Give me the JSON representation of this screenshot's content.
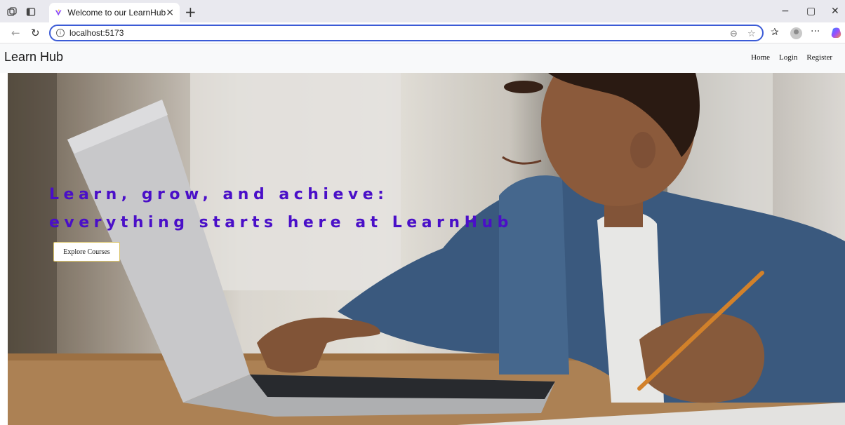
{
  "browser": {
    "tab_title": "Welcome to our LearnHub",
    "url": "localhost:5173",
    "new_tab_symbol": "+",
    "close_tab_symbol": "×",
    "minimize_symbol": "−",
    "restore_symbol": "▢",
    "close_window_symbol": "✕",
    "more_symbol": "···"
  },
  "site": {
    "brand": "Learn Hub",
    "nav": [
      "Home",
      "Login",
      "Register"
    ]
  },
  "hero": {
    "heading_line1": "Learn, grow, and achieve:",
    "heading_line2": "everything starts here at LearnHub",
    "cta_label": "Explore Courses",
    "heading_color": "#4a0fc8"
  },
  "colors": {
    "tabstrip": "#e9e9ef",
    "urlbar_border": "#3b5bd6",
    "header_bg": "#f8f9fa"
  }
}
